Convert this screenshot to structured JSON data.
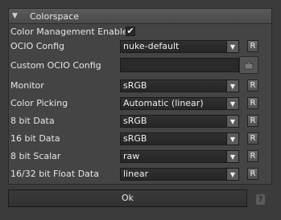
{
  "section": {
    "title": "Colorspace"
  },
  "rows": {
    "color_management": {
      "label": "Color Management Enabled",
      "checked": true,
      "check_glyph": "✔"
    },
    "ocio_config": {
      "label": "OCIO Config",
      "value": "nuke-default",
      "reset": "R"
    },
    "custom_ocio": {
      "label": "Custom OCIO Config",
      "value": "",
      "browse_icon": "folder-icon"
    },
    "monitor": {
      "label": "Monitor",
      "value": "sRGB",
      "reset": "R"
    },
    "color_picking": {
      "label": "Color Picking",
      "value": "Automatic (linear)",
      "reset": "R"
    },
    "bit8_data": {
      "label": "8 bit Data",
      "value": "sRGB",
      "reset": "R"
    },
    "bit16_data": {
      "label": "16 bit Data",
      "value": "sRGB",
      "reset": "R"
    },
    "bit8_scalar": {
      "label": "8 bit Scalar",
      "value": "raw",
      "reset": "R"
    },
    "float_data": {
      "label": "16/32 bit Float Data",
      "value": "linear",
      "reset": "R"
    }
  },
  "footer": {
    "ok_label": "Ok",
    "help_label": "?"
  },
  "icons": {
    "dropdown": "chevron-down-icon",
    "collapse": "triangle-down-icon"
  },
  "colors": {
    "background": "#3b3b3b",
    "panel": "#444444",
    "field": "#2a2a2a"
  }
}
